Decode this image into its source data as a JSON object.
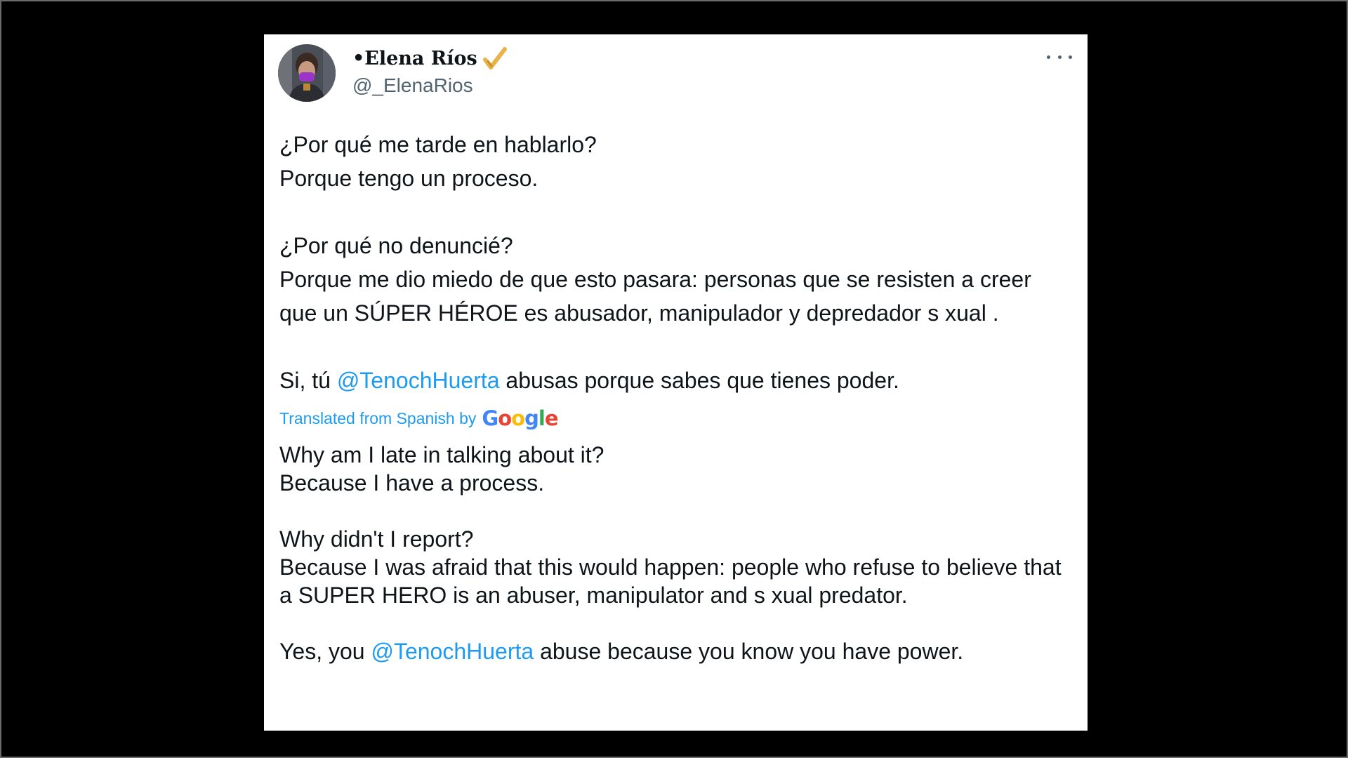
{
  "author": {
    "name": "•Elena Ríos",
    "handle": "@_ElenaRios",
    "badge_icon": "pencil-check-icon",
    "badge_color": "#e8b44a"
  },
  "colors": {
    "link": "#1d9bf0",
    "text": "#0f1419",
    "secondary": "#536471",
    "background": "#000000",
    "card": "#ffffff"
  },
  "tweet": {
    "original": {
      "p1_line1": "¿Por qué me tarde en hablarlo?",
      "p1_line2": "Porque tengo un proceso.",
      "p2_line1": "¿Por qué no denuncié?",
      "p2_line2": "Porque me dio miedo de que esto pasara: personas que se resisten a creer que un SÚPER HÉROE es abusador, manipulador y depredador s  xual .",
      "p3_before": "Si, tú ",
      "p3_mention": "@TenochHuerta",
      "p3_after": " abusas porque sabes que tienes poder."
    },
    "translation": {
      "label": "Translated from Spanish by",
      "provider": {
        "letters": [
          "G",
          "o",
          "o",
          "g",
          "l",
          "e"
        ],
        "colors": [
          "#4285f4",
          "#ea4335",
          "#fbbc05",
          "#4285f4",
          "#34a853",
          "#ea4335"
        ]
      },
      "p1_line1": "Why am I late in talking about it?",
      "p1_line2": "Because I have a process.",
      "p2_line1": "Why didn't I report?",
      "p2_line2": "Because I was afraid that this would happen: people who refuse to believe that a SUPER HERO is an abuser, manipulator and s  xual predator.",
      "p3_before": "Yes, you ",
      "p3_mention": "@TenochHuerta",
      "p3_after": " abuse because you know you have power."
    }
  }
}
